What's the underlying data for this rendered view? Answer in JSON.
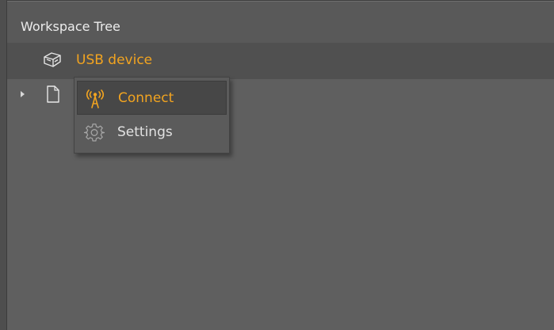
{
  "panel": {
    "title": "Workspace Tree"
  },
  "tree": {
    "device": {
      "label": "USB device",
      "icon": "usb-device-icon"
    },
    "child": {
      "icon": "file-icon",
      "expander_icon": "triangle-right-icon"
    }
  },
  "context_menu": {
    "items": [
      {
        "label": "Connect",
        "icon": "antenna-icon",
        "highlighted": true
      },
      {
        "label": "Settings",
        "icon": "gear-icon",
        "highlighted": false
      }
    ]
  },
  "colors": {
    "accent": "#f2a420",
    "panel_bg": "#5f5f5f",
    "header_bg": "#595959",
    "selected_row_bg": "#505050",
    "menu_hover_bg": "#474747",
    "text": "#ececec"
  }
}
